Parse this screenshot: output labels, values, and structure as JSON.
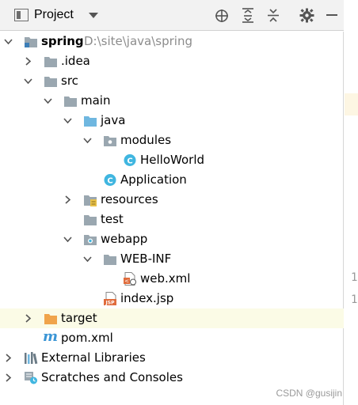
{
  "toolbar": {
    "title": "Project",
    "icons": [
      "project-view-icon",
      "dropdown-arrow-icon",
      "locate-icon",
      "expand-all-icon",
      "collapse-all-icon",
      "settings-icon",
      "minimize-icon"
    ]
  },
  "tree": {
    "rows": [
      {
        "label": "spring",
        "path": "D:\\site\\java\\spring",
        "icon": "module-folder-icon",
        "expanded": true
      },
      {
        "label": ".idea",
        "icon": "folder-icon",
        "expanded": false
      },
      {
        "label": "src",
        "icon": "folder-icon",
        "expanded": true
      },
      {
        "label": "main",
        "icon": "folder-icon",
        "expanded": true
      },
      {
        "label": "java",
        "icon": "source-folder-icon",
        "expanded": true
      },
      {
        "label": "modules",
        "icon": "package-icon",
        "expanded": true
      },
      {
        "label": "HelloWorld",
        "icon": "class-icon"
      },
      {
        "label": "Application",
        "icon": "class-icon"
      },
      {
        "label": "resources",
        "icon": "resources-folder-icon",
        "expanded": false
      },
      {
        "label": "test",
        "icon": "folder-icon"
      },
      {
        "label": "webapp",
        "icon": "web-folder-icon",
        "expanded": true
      },
      {
        "label": "WEB-INF",
        "icon": "folder-icon",
        "expanded": true
      },
      {
        "label": "web.xml",
        "icon": "xml-file-icon"
      },
      {
        "label": "index.jsp",
        "icon": "jsp-file-icon"
      },
      {
        "label": "target",
        "icon": "excluded-folder-icon",
        "expanded": false
      },
      {
        "label": "pom.xml",
        "icon": "maven-icon"
      },
      {
        "label": "External Libraries",
        "icon": "libraries-icon",
        "expanded": false
      },
      {
        "label": "Scratches and Consoles",
        "icon": "scratches-icon",
        "expanded": false
      }
    ]
  },
  "editor": {
    "gutter": [
      "1",
      "1"
    ]
  },
  "watermark": "CSDN @gusijin",
  "colors": {
    "folder": "#9aa7b0",
    "source_folder": "#6fb7e0",
    "excluded_folder": "#f0a44b",
    "class_icon": "#40b6e0",
    "maven": "#3a95d5",
    "selection_highlight": "#fbfbe6"
  }
}
